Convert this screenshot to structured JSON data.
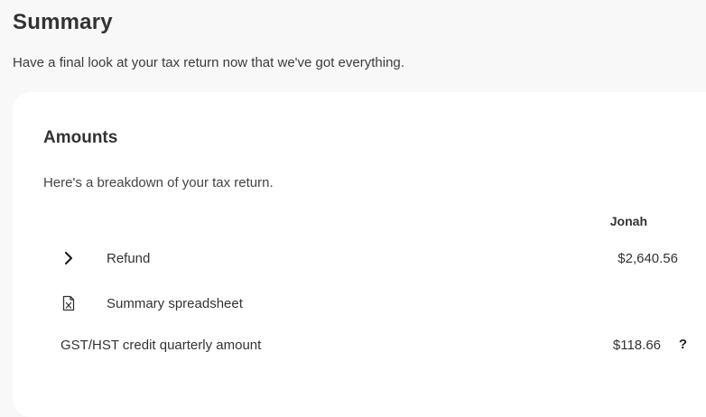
{
  "header": {
    "title": "Summary",
    "subtitle": "Have a final look at your tax return now that we've got everything."
  },
  "amounts": {
    "title": "Amounts",
    "description": "Here's a breakdown of your tax return.",
    "column_header": "Jonah",
    "rows": [
      {
        "icon": "chevron-right-icon",
        "label": "Refund",
        "value": "$2,640.56"
      },
      {
        "icon": "spreadsheet-file-icon",
        "label": "Summary spreadsheet",
        "value": ""
      },
      {
        "icon": "",
        "label": "GST/HST credit quarterly amount",
        "value": "$118.66",
        "help": "?"
      }
    ]
  }
}
